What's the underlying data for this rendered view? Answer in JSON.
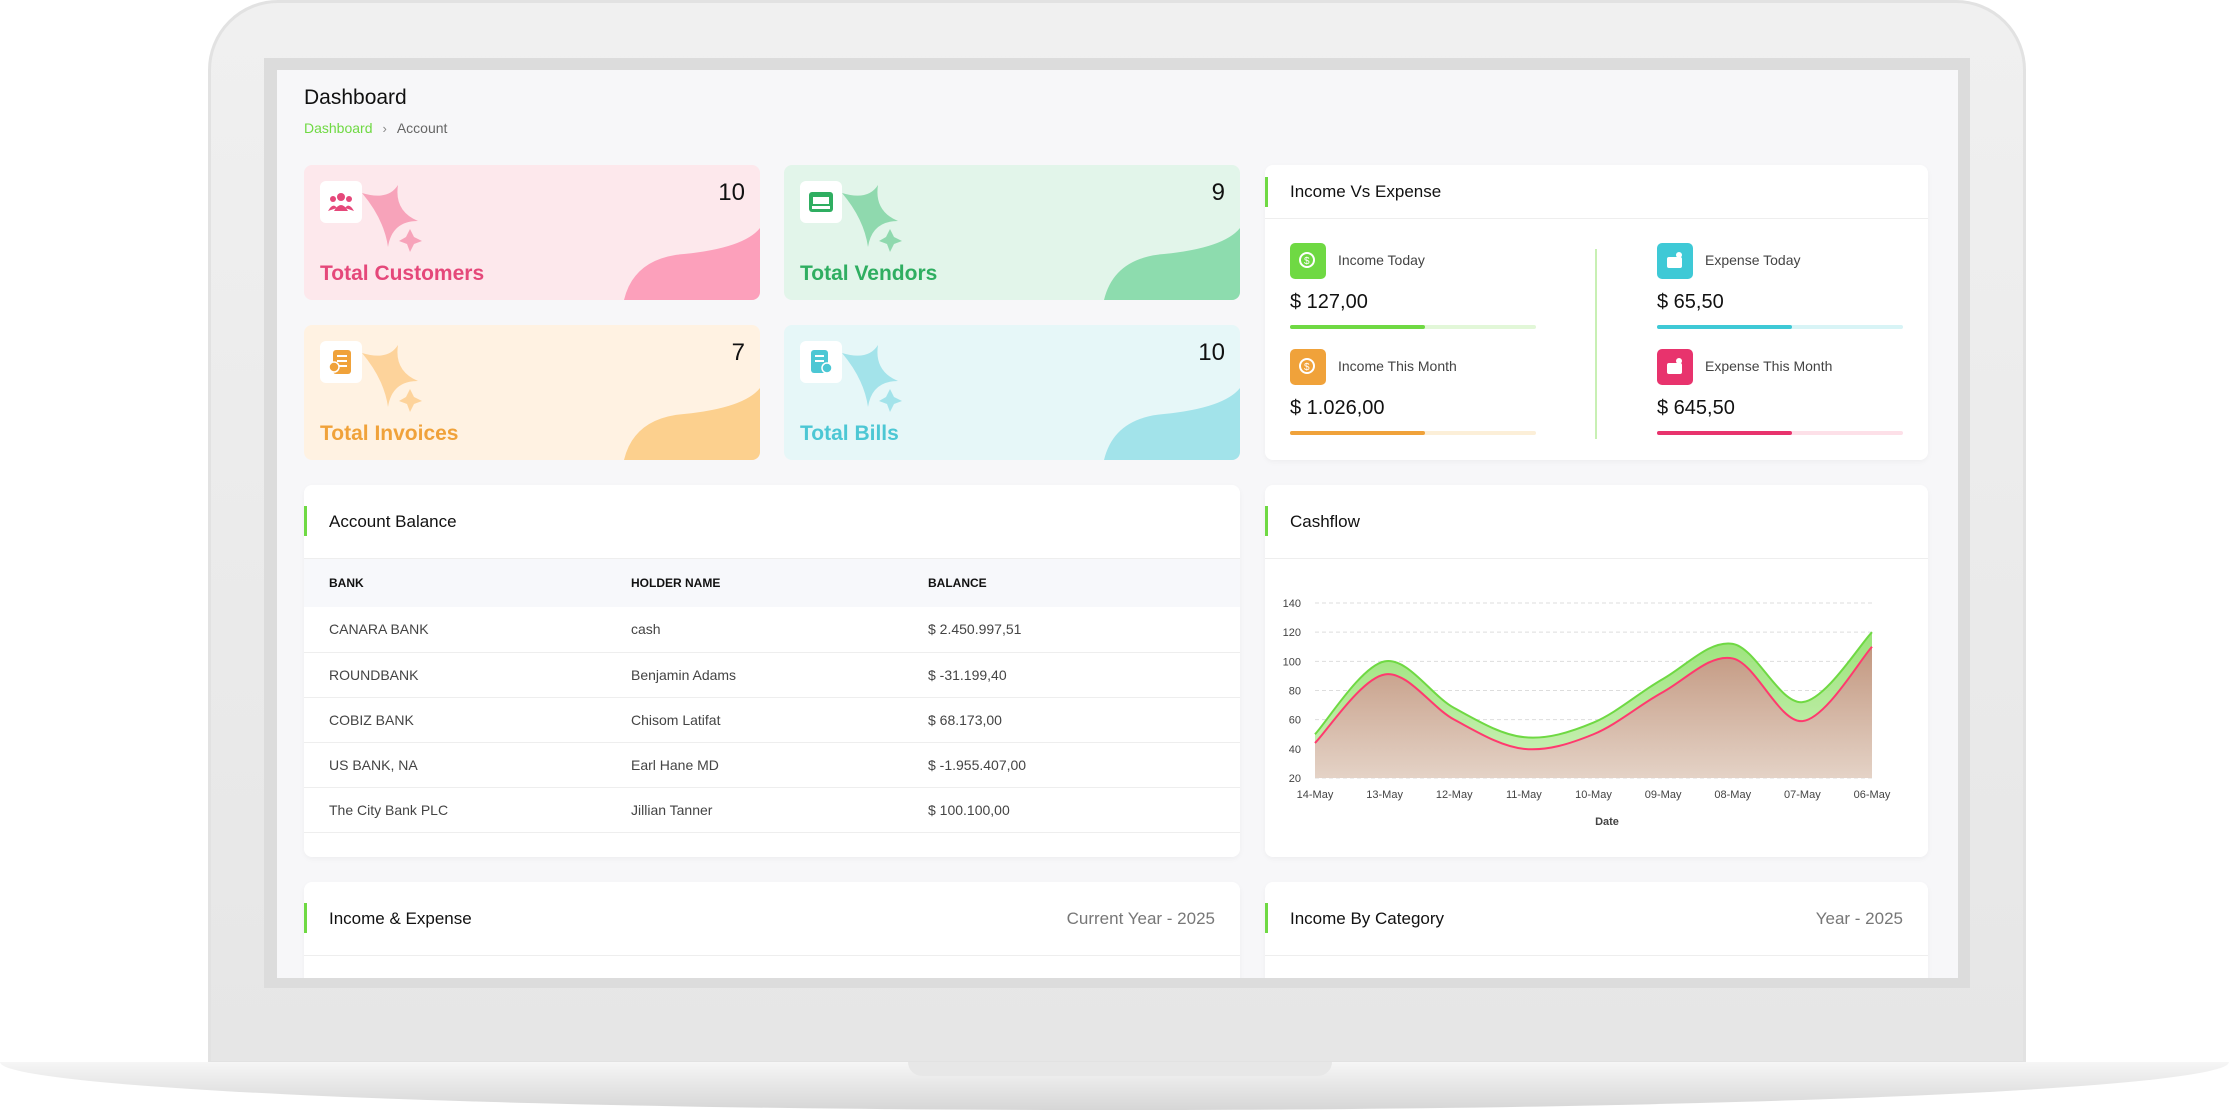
{
  "header": {
    "title": "Dashboard",
    "breadcrumb": [
      "Dashboard",
      "Account"
    ]
  },
  "stats": [
    {
      "label": "Total Customers",
      "value": "10",
      "icon": "users-icon",
      "color": "#e5487a"
    },
    {
      "label": "Total Vendors",
      "value": "9",
      "icon": "store-icon",
      "color": "#2fae61"
    },
    {
      "label": "Total Invoices",
      "value": "7",
      "icon": "invoice-icon",
      "color": "#f0a23a"
    },
    {
      "label": "Total Bills",
      "value": "10",
      "icon": "bill-icon",
      "color": "#4cc7d4"
    }
  ],
  "income_vs_expense": {
    "title": "Income Vs Expense",
    "items": [
      {
        "label": "Income Today",
        "amount": "$ 127,00",
        "color": "#6fd943",
        "progress": 0.55,
        "icon": "income-icon"
      },
      {
        "label": "Expense Today",
        "amount": "$ 65,50",
        "color": "#3ec9d6",
        "progress": 0.55,
        "icon": "wallet-icon"
      },
      {
        "label": "Income This Month",
        "amount": "$ 1.026,00",
        "color": "#f0a23a",
        "progress": 0.55,
        "icon": "income-icon"
      },
      {
        "label": "Expense This Month",
        "amount": "$ 645,50",
        "color": "#e8336d",
        "progress": 0.55,
        "icon": "wallet-icon"
      }
    ]
  },
  "account_balance": {
    "title": "Account Balance",
    "columns": [
      "BANK",
      "HOLDER NAME",
      "BALANCE"
    ],
    "rows": [
      [
        "CANARA BANK",
        "cash",
        "$ 2.450.997,51"
      ],
      [
        "ROUNDBANK",
        "Benjamin Adams",
        "$ -31.199,40"
      ],
      [
        "COBIZ BANK",
        "Chisom Latifat",
        "$ 68.173,00"
      ],
      [
        "US BANK, NA",
        "Earl Hane MD",
        "$ -1.955.407,00"
      ],
      [
        "The City Bank PLC",
        "Jillian Tanner",
        "$ 100.100,00"
      ]
    ]
  },
  "cashflow": {
    "title": "Cashflow"
  },
  "income_expense": {
    "title": "Income & Expense",
    "period": "Current Year - 2025"
  },
  "income_by_category": {
    "title": "Income By Category",
    "period": "Year - 2025"
  },
  "chart_data": {
    "type": "area",
    "title": "Cashflow",
    "xlabel": "Date",
    "ylabel": "",
    "x": [
      "14-May",
      "13-May",
      "12-May",
      "11-May",
      "10-May",
      "09-May",
      "08-May",
      "07-May",
      "06-May"
    ],
    "yticks": [
      20,
      40,
      60,
      80,
      100,
      120,
      140
    ],
    "ylim": [
      20,
      140
    ],
    "grid": true,
    "series": [
      {
        "values": [
          50,
          100,
          68,
          48,
          58,
          88,
          112,
          72,
          120
        ],
        "color": "#6fd943"
      },
      {
        "values": [
          44,
          91,
          60,
          40,
          50,
          79,
          102,
          59,
          110
        ],
        "color": "#ff3a6e"
      }
    ]
  }
}
